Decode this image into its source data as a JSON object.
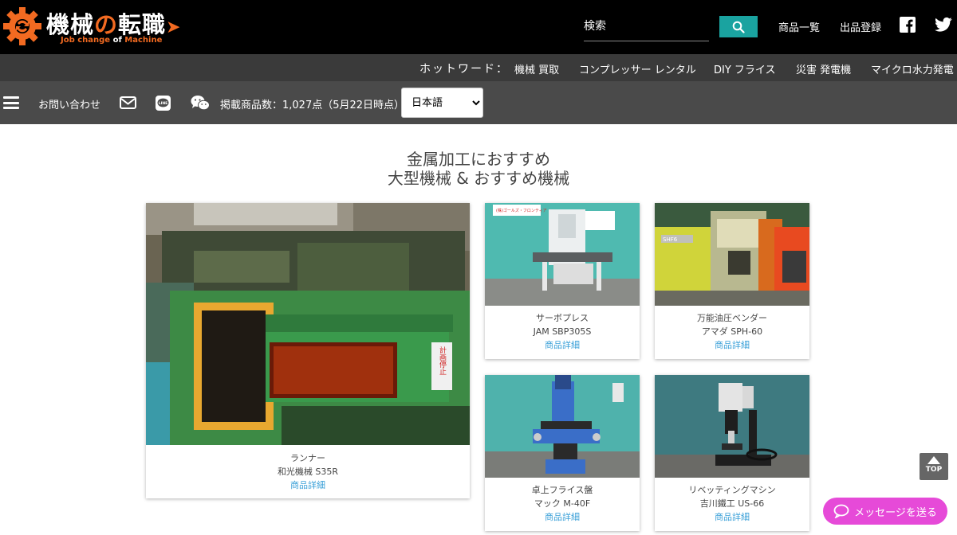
{
  "header": {
    "logo_title_1": "機械",
    "logo_title_2": "の",
    "logo_title_3": "転職",
    "logo_sub_1": "Job change ",
    "logo_sub_2": "of",
    "logo_sub_3": " Machine",
    "search_placeholder": "検索",
    "nav": [
      "商品一覧",
      "出品登録"
    ],
    "brand_color": "#f26a21",
    "accent_color": "#1aa3a0"
  },
  "hotwords": {
    "label": "ホットワード：",
    "items": [
      "機械 買取",
      "コンプレッサー レンタル",
      "DIY フライス",
      "災害 発電機",
      "マイクロ水力発電"
    ]
  },
  "toolbar": {
    "contact": "お問い合わせ",
    "count_text": "掲載商品数：1,027点（5月22日時点）",
    "language": "日本語"
  },
  "section": {
    "title_line1": "金属加工におすすめ",
    "title_line2": "大型機械 & おすすめ機械"
  },
  "products": [
    {
      "category": "ランナー",
      "name": "和光機械 S35R",
      "link": "商品詳細"
    },
    {
      "category": "サーボプレス",
      "name": "JAM SBP305S",
      "link": "商品詳細"
    },
    {
      "category": "万能油圧ベンダー",
      "name": "アマダ SPH-60",
      "link": "商品詳細"
    },
    {
      "category": "卓上フライス盤",
      "name": "マック M-40F",
      "link": "商品詳細"
    },
    {
      "category": "リベッティングマシン",
      "name": "吉川鐵工 US-66",
      "link": "商品詳細"
    }
  ],
  "photo_text": {
    "press_sign": "(株)ゴールズ・フロンティア",
    "bender_label": "SHF6",
    "runner_sign": "計画停止"
  },
  "floating": {
    "top": "TOP",
    "message": "メッセージを送る"
  }
}
